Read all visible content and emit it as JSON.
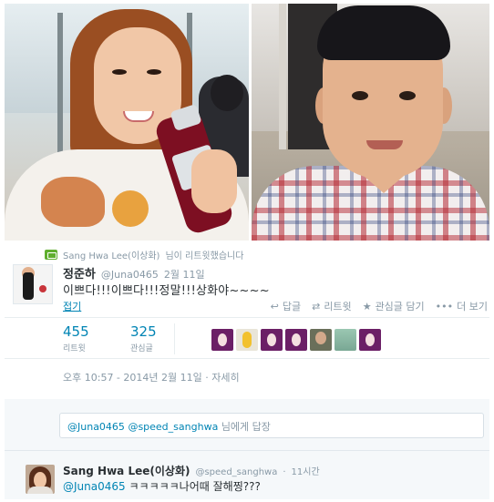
{
  "retweet_notice": {
    "name": "Sang Hwa Lee(이상화)",
    "suffix": "님이 리트윗했습니다"
  },
  "tweet": {
    "name": "정준하",
    "handle": "@Juna0465",
    "date": "2월 11일",
    "text": "이쁘다!!!이쁘다!!!정말!!!상화야~~~~",
    "fold_label": "접기",
    "actions": {
      "reply": "답글",
      "retweet": "리트윗",
      "favorite": "관심글 담기",
      "more": "더 보기"
    },
    "stats": {
      "retweets": "455",
      "retweets_label": "리트윗",
      "favorites": "325",
      "favorites_label": "관심글"
    },
    "timestamp": "오후 10:57 - 2014년 2월 11일",
    "details_link": "자세히"
  },
  "reply_box": {
    "handle1": "@Juna0465",
    "handle2": "@speed_sanghwa",
    "tail": "님에게 답장"
  },
  "reply": {
    "name": "Sang Hwa Lee(이상화)",
    "handle": "@speed_sanghwa",
    "time": "11시간",
    "mention": "@Juna0465",
    "text": "ㅋㅋㅋㅋㅋ나어때 잘해찡???"
  },
  "icons": {
    "retweet_badge": "retweet-badge-icon",
    "reply": "reply-icon",
    "retweet": "retweet-icon",
    "favorite": "star-icon",
    "more": "more-icon"
  },
  "colors": {
    "link": "#0084b4",
    "muted": "#8899a6",
    "text": "#292f33",
    "retweet_green": "#5fae2e"
  }
}
